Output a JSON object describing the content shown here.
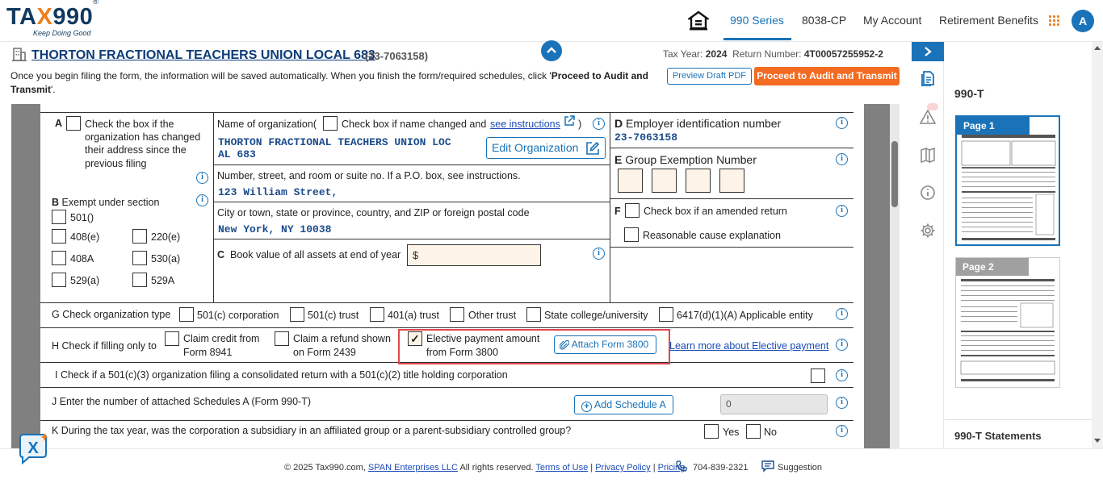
{
  "header": {
    "logo_text": "TAX990",
    "logo_reg": "®",
    "tagline": "Keep Doing Good",
    "nav": [
      "990 Series",
      "8038-CP",
      "My Account",
      "Retirement Benefits"
    ],
    "avatar_letter": "A"
  },
  "title_band": {
    "org_name": "THORTON FRACTIONAL TEACHERS UNION LOCAL 683",
    "org_ein": "(23-7063158)",
    "tax_year_label": "Tax Year:",
    "tax_year": "2024",
    "return_label": "Return Number:",
    "return_number": "4T00057255952-2",
    "info_text_1": "Once you begin filing the form, the information will be saved automatically. When you finish the form/required schedules, click '",
    "info_text_bold": "Proceed to Audit and Transmit",
    "info_text_2": "'.",
    "preview_btn": "Preview Draft PDF",
    "audit_btn": "Proceed to Audit and Transmit"
  },
  "form": {
    "a_label": "A",
    "a_text": [
      "Check the box if the",
      "organization has changed",
      "their address since the",
      "previous filing"
    ],
    "b_label": "B",
    "b_text": "Exempt under section",
    "b_options": [
      "501()",
      "408(e)",
      "220(e)",
      "408A",
      "530(a)",
      "529(a)",
      "529A"
    ],
    "name_label": "Name of organization(",
    "name_check_text": "Check box if name changed and",
    "name_link": "see instructions",
    "name_close": ")",
    "org_name_line1": "THORTON FRACTIONAL TEACHERS UNION LOC",
    "org_name_line2": "AL 683",
    "edit_org": "Edit Organization",
    "street_label": "Number, street, and room or suite no. If a P.O. box, see instructions.",
    "street_value": "123 William Street,",
    "city_label": "City or town, state or province, country, and ZIP or foreign postal code",
    "city_value": "New York, NY 10038",
    "c_label": "C",
    "c_text": "Book value of all assets at end of year",
    "c_prefix": "$",
    "d_label": "D",
    "d_text": "Employer identification number",
    "d_value": "23-7063158",
    "e_label": "E",
    "e_text": "Group Exemption Number",
    "f_label": "F",
    "f_text": "Check box if an amended return",
    "reasonable_text": "Reasonable cause explanation",
    "g_text": "G Check organization type",
    "g_options": [
      "501(c) corporation",
      "501(c) trust",
      "401(a) trust",
      "Other trust",
      "State college/university",
      "6417(d)(1)(A) Applicable entity"
    ],
    "h_text": "H Check if filling only to",
    "h_opt1": [
      "Claim credit from",
      "Form 8941"
    ],
    "h_opt2": [
      "Claim a refund shown",
      "on Form 2439"
    ],
    "h_opt3": [
      "Elective payment amount",
      "from Form 3800"
    ],
    "attach_btn": "Attach Form 3800",
    "learn_link": "Learn more about Elective payment",
    "i_text": "I  Check if a 501(c)(3) organization filing a consolidated return with a 501(c)(2) title holding corporation",
    "j_text": "J  Enter the number of attached Schedules A (Form 990-T)",
    "add_schedule": "Add Schedule A",
    "schedule_count": "0",
    "k_text": "K  During the tax year, was the corporation a subsidiary in an affiliated group or a parent-subsidiary controlled group?",
    "k_yes": "Yes",
    "k_no": "No"
  },
  "thumbs": {
    "title": "990-T",
    "page1": "Page 1",
    "page2": "Page 2",
    "footer": "990-T Statements"
  },
  "footer": {
    "copyright": "© 2025 Tax990.com,",
    "span": "SPAN Enterprises LLC",
    "rights": "All rights reserved.",
    "terms": "Terms of Use",
    "privacy": "Privacy Policy",
    "pricing": "Pricing",
    "phone": "704-839-2321",
    "suggestion": "Suggestion",
    "sep": "|"
  },
  "colors": {
    "brand_blue": "#1a73b8",
    "brand_orange": "#f26b21",
    "highlight_red": "#e0474c"
  }
}
